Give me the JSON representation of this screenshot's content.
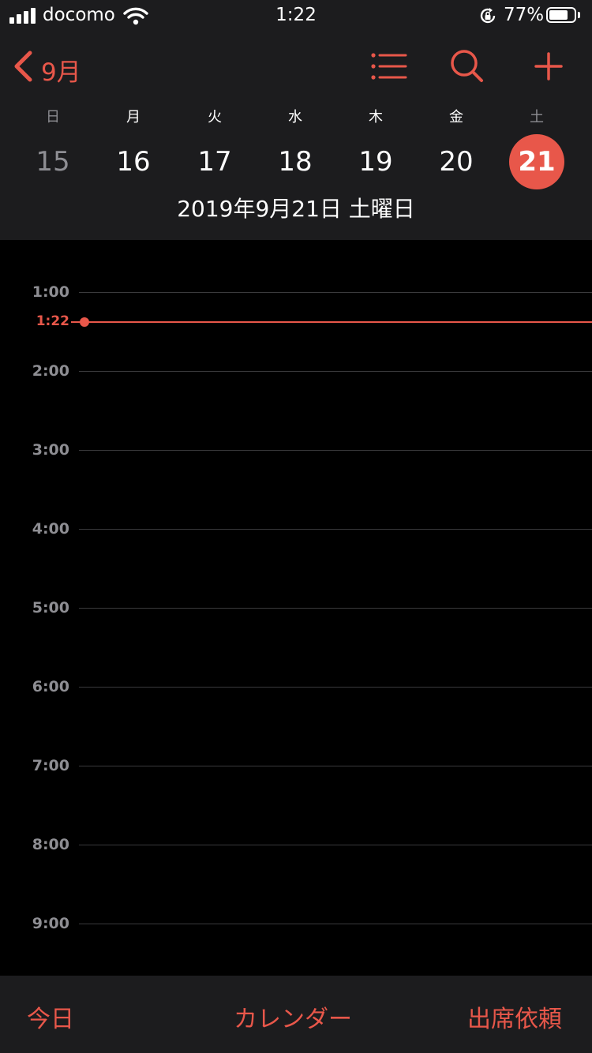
{
  "status": {
    "carrier": "docomo",
    "time": "1:22",
    "battery_percent": "77%",
    "battery_level": 0.77
  },
  "nav": {
    "back_label": "9月",
    "icons": [
      "chevron-left-icon",
      "list-icon",
      "search-icon",
      "plus-icon"
    ]
  },
  "week": {
    "weekdays": [
      "日",
      "月",
      "火",
      "水",
      "木",
      "金",
      "土"
    ],
    "dates": [
      "15",
      "16",
      "17",
      "18",
      "19",
      "20",
      "21"
    ],
    "selected_index": 6,
    "full_date": "2019年9月21日 土曜日"
  },
  "timeline": {
    "hours": [
      "1:00",
      "2:00",
      "3:00",
      "4:00",
      "5:00",
      "6:00",
      "7:00",
      "8:00",
      "9:00"
    ],
    "now_label": "1:22"
  },
  "tabbar": {
    "today": "今日",
    "calendars": "カレンダー",
    "inbox": "出席依頼"
  },
  "colors": {
    "accent": "#e8574a",
    "header_bg": "#1c1c1e",
    "background": "#000000",
    "muted": "#8e8e93"
  }
}
